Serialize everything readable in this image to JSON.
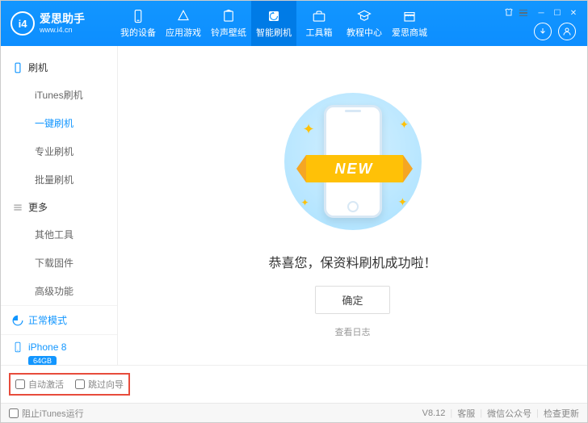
{
  "brand": {
    "title": "爱思助手",
    "subtitle": "www.i4.cn",
    "logo_text": "i4"
  },
  "nav": [
    {
      "label": "我的设备",
      "icon": "device"
    },
    {
      "label": "应用游戏",
      "icon": "apps"
    },
    {
      "label": "铃声壁纸",
      "icon": "ringtone"
    },
    {
      "label": "智能刷机",
      "icon": "flash",
      "active": true
    },
    {
      "label": "工具箱",
      "icon": "toolbox"
    },
    {
      "label": "教程中心",
      "icon": "tutorial"
    },
    {
      "label": "爱思商城",
      "icon": "store"
    }
  ],
  "sidebar": {
    "groups": [
      {
        "title": "刷机",
        "icon": "phone",
        "items": [
          "iTunes刷机",
          "一键刷机",
          "专业刷机",
          "批量刷机"
        ],
        "active_index": 1
      },
      {
        "title": "更多",
        "icon": "menu",
        "items": [
          "其他工具",
          "下载固件",
          "高级功能"
        ],
        "active_index": -1
      }
    ],
    "mode": "正常模式",
    "device": {
      "name": "iPhone 8",
      "storage": "64GB"
    }
  },
  "main": {
    "ribbon_text": "NEW",
    "success_text": "恭喜您，保资料刷机成功啦！",
    "ok_button": "确定",
    "log_link": "查看日志"
  },
  "bottom": {
    "auto_activate": "自动激活",
    "skip_guide": "跳过向导"
  },
  "footer": {
    "block_itunes": "阻止iTunes运行",
    "version": "V8.12",
    "links": [
      "客服",
      "微信公众号",
      "检查更新"
    ]
  }
}
